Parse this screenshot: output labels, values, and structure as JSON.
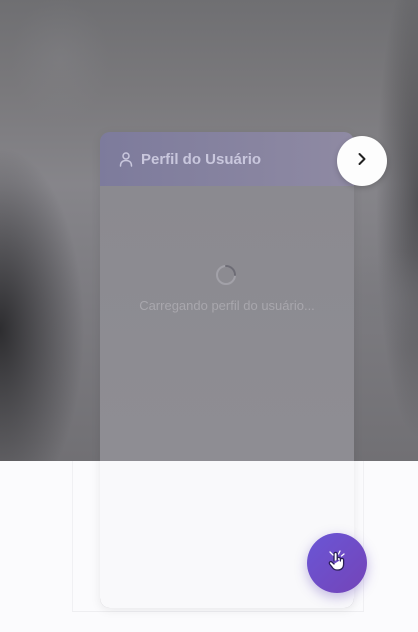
{
  "profile_panel": {
    "title": "Perfil do Usuário",
    "title_icon": "user-icon",
    "loading_text": "Carregando perfil do usuário..."
  },
  "navigation": {
    "next_icon": "chevron-right-icon"
  },
  "fab": {
    "icon": "hand-pointer-icon",
    "color_start": "#6a56d6",
    "color_end": "#7444b8"
  },
  "colors": {
    "header_gradient_start": "#7d7b9c",
    "header_gradient_end": "#8f8aa3",
    "overlay": "#8b8a90"
  }
}
